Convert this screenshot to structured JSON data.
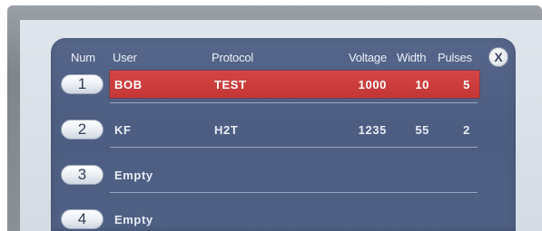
{
  "table": {
    "headers": {
      "num": "Num",
      "user": "User",
      "protocol": "Protocol",
      "voltage": "Voltage",
      "width": "Width",
      "pulses": "Pulses"
    },
    "close_label": "X",
    "rows": [
      {
        "num": "1",
        "user": "BOB",
        "protocol": "TEST",
        "voltage": "1000",
        "width": "10",
        "pulses": "5",
        "selected": true
      },
      {
        "num": "2",
        "user": "KF",
        "protocol": "H2T",
        "voltage": "1235",
        "width": "55",
        "pulses": "2",
        "selected": false
      },
      {
        "num": "3",
        "user": "Empty",
        "protocol": "",
        "voltage": "",
        "width": "",
        "pulses": "",
        "selected": false
      },
      {
        "num": "4",
        "user": "Empty",
        "protocol": "",
        "voltage": "",
        "width": "",
        "pulses": "",
        "selected": false
      }
    ]
  },
  "colors": {
    "panel": "#4f6084",
    "selected_row": "#c93b3b",
    "pill": "#e9edf3",
    "text": "#ffffff"
  }
}
